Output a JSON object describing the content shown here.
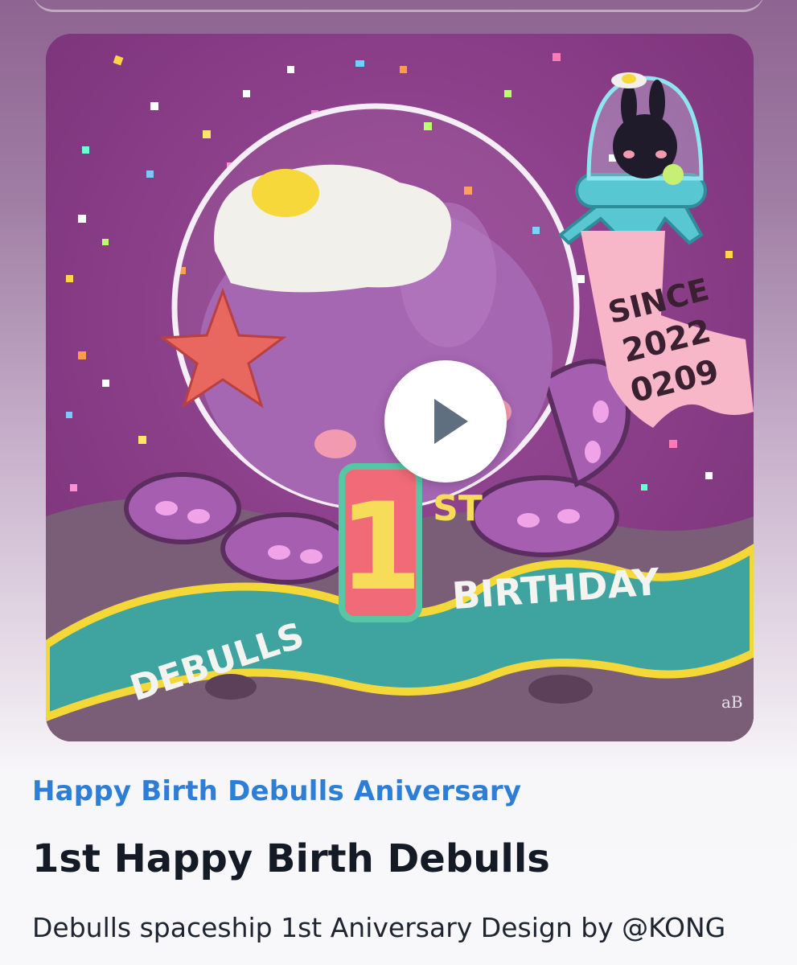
{
  "artwork": {
    "banner_text": [
      "SINCE",
      "2022",
      "0209"
    ],
    "badge_number": "1",
    "badge_suffix": "ST",
    "ribbon_left": "DEBULLS",
    "ribbon_right": "BIRTHDAY",
    "signature": "aB"
  },
  "media": {
    "play_icon": "play-icon"
  },
  "content": {
    "collection": "Happy Birth Debulls Aniversary",
    "title": "1st Happy Birth Debulls",
    "description": "Debulls spaceship 1st Aniversary Design by @KONG"
  }
}
